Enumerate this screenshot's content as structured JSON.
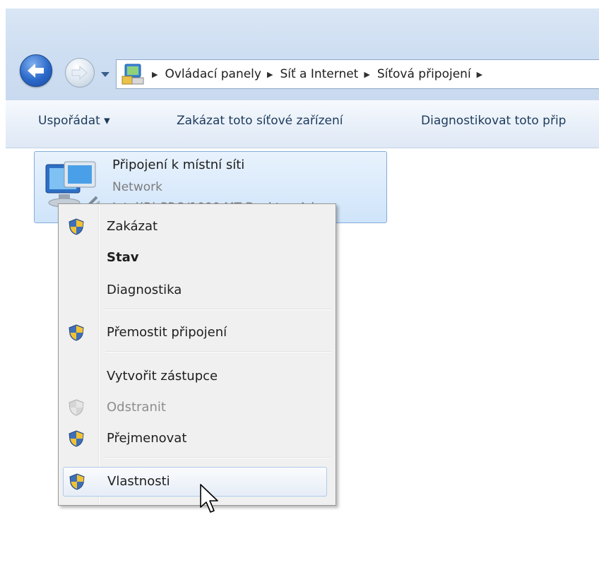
{
  "nav": {
    "back_icon": "back-arrow-icon",
    "forward_icon": "forward-arrow-icon",
    "history_icon": "chevron-down-icon"
  },
  "address": {
    "root_icon": "control-panel-icon",
    "crumbs": [
      "Ovládací panely",
      "Síť a Internet",
      "Síťová připojení"
    ]
  },
  "toolbar": {
    "organize": "Uspořádat ▾",
    "disable_device": "Zakázat toto síťové zařízení",
    "diagnose_device": "Diagnostikovat toto přip"
  },
  "connection": {
    "name": "Připojení k místní síti",
    "network": "Network",
    "adapter": "Intel(R) PRO/1000 MT Desktop Ad..."
  },
  "context_menu": {
    "items": [
      {
        "label": "Zakázat",
        "shield": true
      },
      {
        "label": "Stav",
        "bold": true
      },
      {
        "label": "Diagnostika"
      },
      {
        "label": "Přemostit připojení",
        "shield": true
      },
      {
        "label": "Vytvořit zástupce"
      },
      {
        "label": "Odstranit",
        "disabled": true,
        "shield": true
      },
      {
        "label": "Přejmenovat",
        "shield": true
      },
      {
        "label": "Vlastnosti",
        "shield": true,
        "hover": true
      }
    ]
  },
  "colors": {
    "accent": "#2a68c9",
    "selection": "#cfe4fa",
    "menu_bg": "#f0f0f0"
  }
}
